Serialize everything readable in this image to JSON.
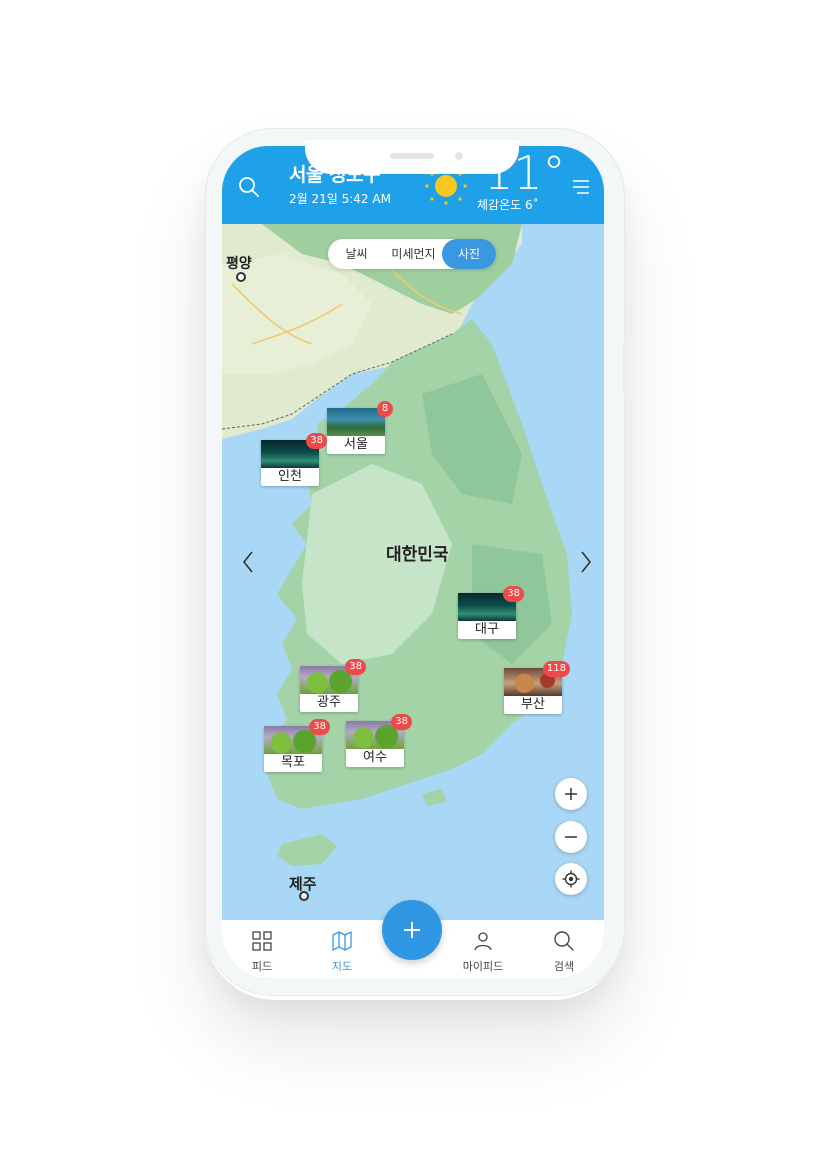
{
  "header": {
    "city": "서울 성도구",
    "datetime": "2월 21일 5:42 AM",
    "temperature": "11°",
    "feels_like": "체감온도 6˚",
    "weather_icon": "sun-icon",
    "accent_color": "#1ea1e9"
  },
  "tabs": {
    "items": [
      "날씨",
      "미세먼지",
      "사진"
    ],
    "selected": "사진"
  },
  "map": {
    "country_label": "대한민국",
    "place_labels": {
      "pyongyang": "평양",
      "jeju": "제주"
    },
    "pins": [
      {
        "name": "서울",
        "count": "8",
        "thumb": "mountain"
      },
      {
        "name": "인천",
        "count": "38",
        "thumb": "night"
      },
      {
        "name": "대구",
        "count": "38",
        "thumb": "night"
      },
      {
        "name": "광주",
        "count": "38",
        "thumb": "salad"
      },
      {
        "name": "부산",
        "count": "118",
        "thumb": "food"
      },
      {
        "name": "목포",
        "count": "38",
        "thumb": "salad"
      },
      {
        "name": "여수",
        "count": "38",
        "thumb": "salad"
      }
    ],
    "badge_color": "#ef4a4a"
  },
  "nav": {
    "items": [
      "피드",
      "지도",
      "마이피드",
      "검색"
    ],
    "active": "지도",
    "fab": "plus-icon"
  }
}
